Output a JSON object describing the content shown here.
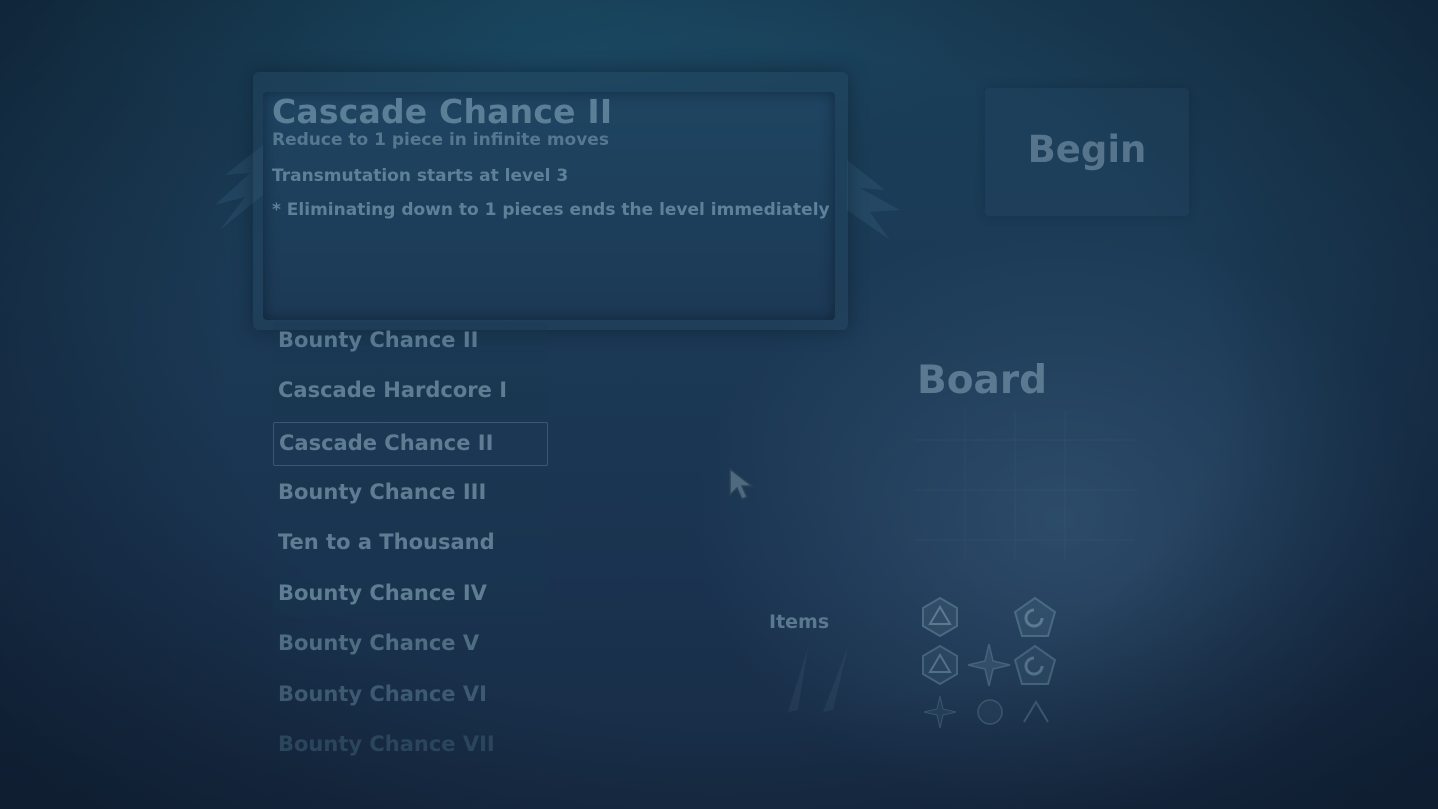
{
  "tooltip": {
    "title": "Cascade Chance II",
    "subtitle": "Reduce to 1 piece in infinite moves",
    "line1": "Transmutation starts at level 3",
    "line2": "* Eliminating down to 1 pieces ends the level immediately"
  },
  "begin_button": {
    "label": "Begin"
  },
  "level_list": {
    "items": [
      {
        "label": "Bounty Chance II"
      },
      {
        "label": "Cascade Hardcore I"
      },
      {
        "label": "Cascade Chance II",
        "selected": true
      },
      {
        "label": "Bounty Chance III"
      },
      {
        "label": "Ten to a Thousand"
      },
      {
        "label": "Bounty Chance IV"
      },
      {
        "label": "Bounty Chance V"
      },
      {
        "label": "Bounty Chance VI"
      },
      {
        "label": "Bounty Chance VII"
      }
    ]
  },
  "board": {
    "title": "Board"
  },
  "items_panel": {
    "label": "Items",
    "icons": [
      "triangle-rune-icon",
      "swirl-rune-icon",
      "triangle-rune-icon",
      "cross-rune-icon",
      "swirl-rune-icon",
      "cross-rune-icon",
      "circle-rune-icon",
      "arrow-rune-icon"
    ]
  },
  "colors": {
    "background": "#1b3a55",
    "text": "#5e7d93",
    "panel": "#1f4562"
  }
}
